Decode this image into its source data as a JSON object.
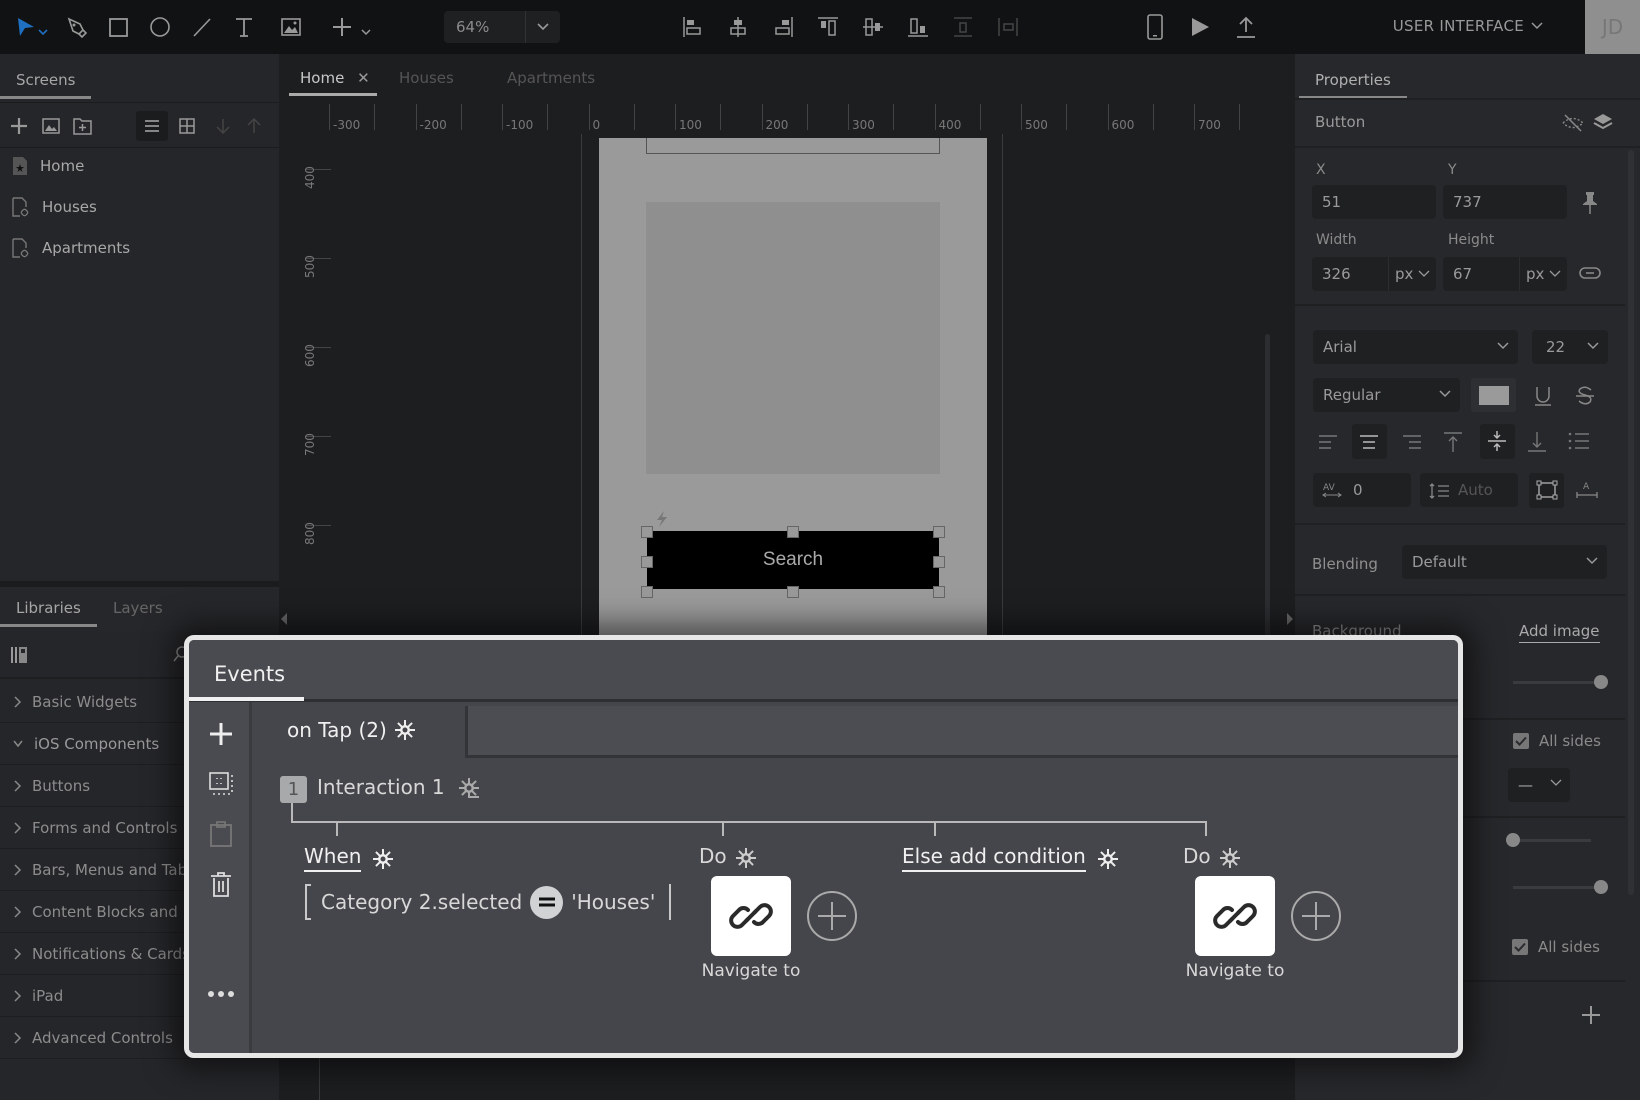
{
  "topbar": {
    "tools": [
      "select-tool",
      "pen-tool",
      "rectangle-tool",
      "ellipse-tool",
      "line-tool",
      "text-tool",
      "image-tool",
      "add-tool"
    ],
    "zoom": "64%",
    "align_tools": [
      "align-left",
      "align-center-horizontal",
      "align-right",
      "align-top",
      "align-center-vertical",
      "align-bottom",
      "distribute-vertical",
      "distribute-horizontal"
    ],
    "workspace_label": "USER INTERFACE",
    "avatar_initials": "JD"
  },
  "left_panel": {
    "screens_tab": "Screens",
    "screens": [
      {
        "label": "Home",
        "icon": "home-screen-icon"
      },
      {
        "label": "Houses",
        "icon": "linked-screen-icon"
      },
      {
        "label": "Apartments",
        "icon": "linked-screen-icon"
      }
    ],
    "libraries_tab": "Libraries",
    "layers_tab": "Layers",
    "libraries": [
      {
        "label": "Basic Widgets",
        "expanded": false
      },
      {
        "label": "iOS Components",
        "expanded": true
      },
      {
        "label": "Buttons",
        "expanded": false
      },
      {
        "label": "Forms and Controls",
        "expanded": false
      },
      {
        "label": "Bars, Menus and Tabs",
        "expanded": false
      },
      {
        "label": "Content Blocks and Data",
        "expanded": false
      },
      {
        "label": "Notifications & Cards",
        "expanded": false
      },
      {
        "label": "iPad",
        "expanded": false
      },
      {
        "label": "Advanced Controls",
        "expanded": false
      }
    ]
  },
  "canvas": {
    "tabs": [
      {
        "label": "Home",
        "active": true,
        "closable": true
      },
      {
        "label": "Houses",
        "active": false
      },
      {
        "label": "Apartments",
        "active": false
      }
    ],
    "hruler_labels": [
      "-300",
      "-200",
      "-100",
      "0",
      "100",
      "200",
      "300",
      "400",
      "500",
      "600",
      "700"
    ],
    "vruler_labels": [
      "400",
      "500",
      "600",
      "700",
      "800"
    ],
    "button_text": "Search"
  },
  "properties": {
    "tab": "Properties",
    "element_type": "Button",
    "x_label": "X",
    "x": "51",
    "y_label": "Y",
    "y": "737",
    "width_label": "Width",
    "width": "326",
    "width_unit": "px",
    "height_label": "Height",
    "height": "67",
    "height_unit": "px",
    "font": "Arial",
    "font_size": "22",
    "font_weight": "Regular",
    "text_color": "#9a9a9a",
    "letter_spacing": "0",
    "line_height_placeholder": "Auto",
    "blending_label": "Blending",
    "blending": "Default",
    "background_label": "Background",
    "add_image": "Add image",
    "all_sides_1": "All sides",
    "all_sides_2": "All sides",
    "border_style": "—",
    "slider_opacity": 1.0,
    "slider_2": 0.0,
    "slider_3": 1.0
  },
  "events": {
    "title": "Events",
    "trigger": "on Tap (2)",
    "interaction_number": "1",
    "interaction_label": "Interaction 1",
    "when_label": "When",
    "condition_left": "Category 2.selected",
    "condition_operator": "=",
    "condition_right": "'Houses'",
    "do_label_1": "Do",
    "action_1": "Navigate to",
    "else_label": "Else add condition",
    "do_label_2": "Do",
    "action_2": "Navigate to"
  }
}
